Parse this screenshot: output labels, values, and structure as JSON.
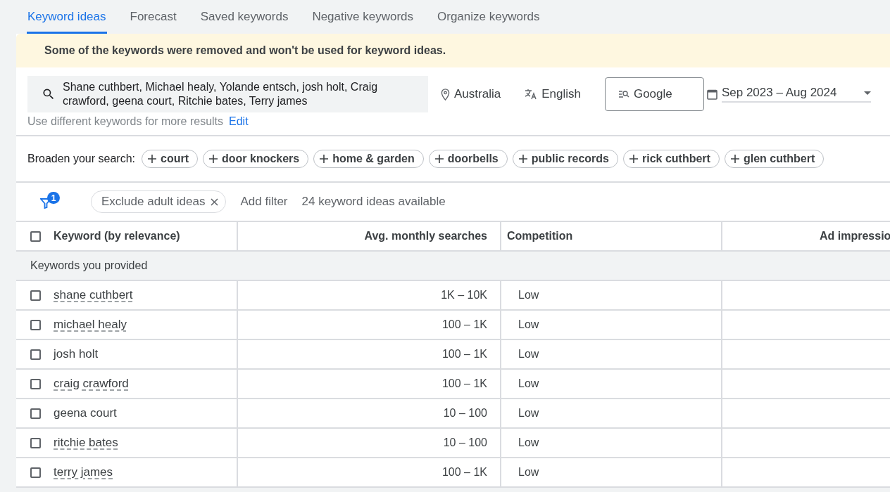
{
  "tabs": [
    {
      "label": "Keyword ideas",
      "selected": true
    },
    {
      "label": "Forecast",
      "selected": false
    },
    {
      "label": "Saved keywords",
      "selected": false
    },
    {
      "label": "Negative keywords",
      "selected": false
    },
    {
      "label": "Organize keywords",
      "selected": false
    }
  ],
  "banner": "Some of the keywords were removed and won't be used for keyword ideas.",
  "search": {
    "value": "Shane cuthbert, Michael healy, Yolande entsch, josh holt, Craig crawford, geena court, Ritchie bates, Terry james",
    "hint": "Use different keywords for more results",
    "edit_link": "Edit"
  },
  "location": "Australia",
  "language": "English",
  "network": "Google",
  "date_range": "Sep 2023 – Aug 2024",
  "broaden": {
    "label": "Broaden your search:",
    "chips": [
      "court",
      "door knockers",
      "home & garden",
      "doorbells",
      "public records",
      "rick cuthbert",
      "glen cuthbert"
    ]
  },
  "filters": {
    "count_badge": "1",
    "chips": [
      "Exclude adult ideas"
    ],
    "add_filter": "Add filter",
    "summary": "24 keyword ideas available"
  },
  "table": {
    "columns": [
      "Keyword (by relevance)",
      "Avg. monthly searches",
      "Competition",
      "Ad impressio"
    ],
    "header_checked": false,
    "group": "Keywords you provided",
    "rows": [
      {
        "keyword": "shane cuthbert",
        "underlined": true,
        "checked": false,
        "searches": "1K – 10K",
        "competition": "Low"
      },
      {
        "keyword": "michael healy",
        "underlined": true,
        "checked": false,
        "searches": "100 – 1K",
        "competition": "Low"
      },
      {
        "keyword": "josh holt",
        "underlined": false,
        "checked": false,
        "searches": "100 – 1K",
        "competition": "Low"
      },
      {
        "keyword": "craig crawford",
        "underlined": true,
        "checked": false,
        "searches": "100 – 1K",
        "competition": "Low"
      },
      {
        "keyword": "geena court",
        "underlined": false,
        "checked": false,
        "searches": "10 – 100",
        "competition": "Low"
      },
      {
        "keyword": "ritchie bates",
        "underlined": true,
        "checked": false,
        "searches": "10 – 100",
        "competition": "Low"
      },
      {
        "keyword": "terry james",
        "underlined": true,
        "checked": false,
        "searches": "100 – 1K",
        "competition": "Low"
      }
    ]
  }
}
